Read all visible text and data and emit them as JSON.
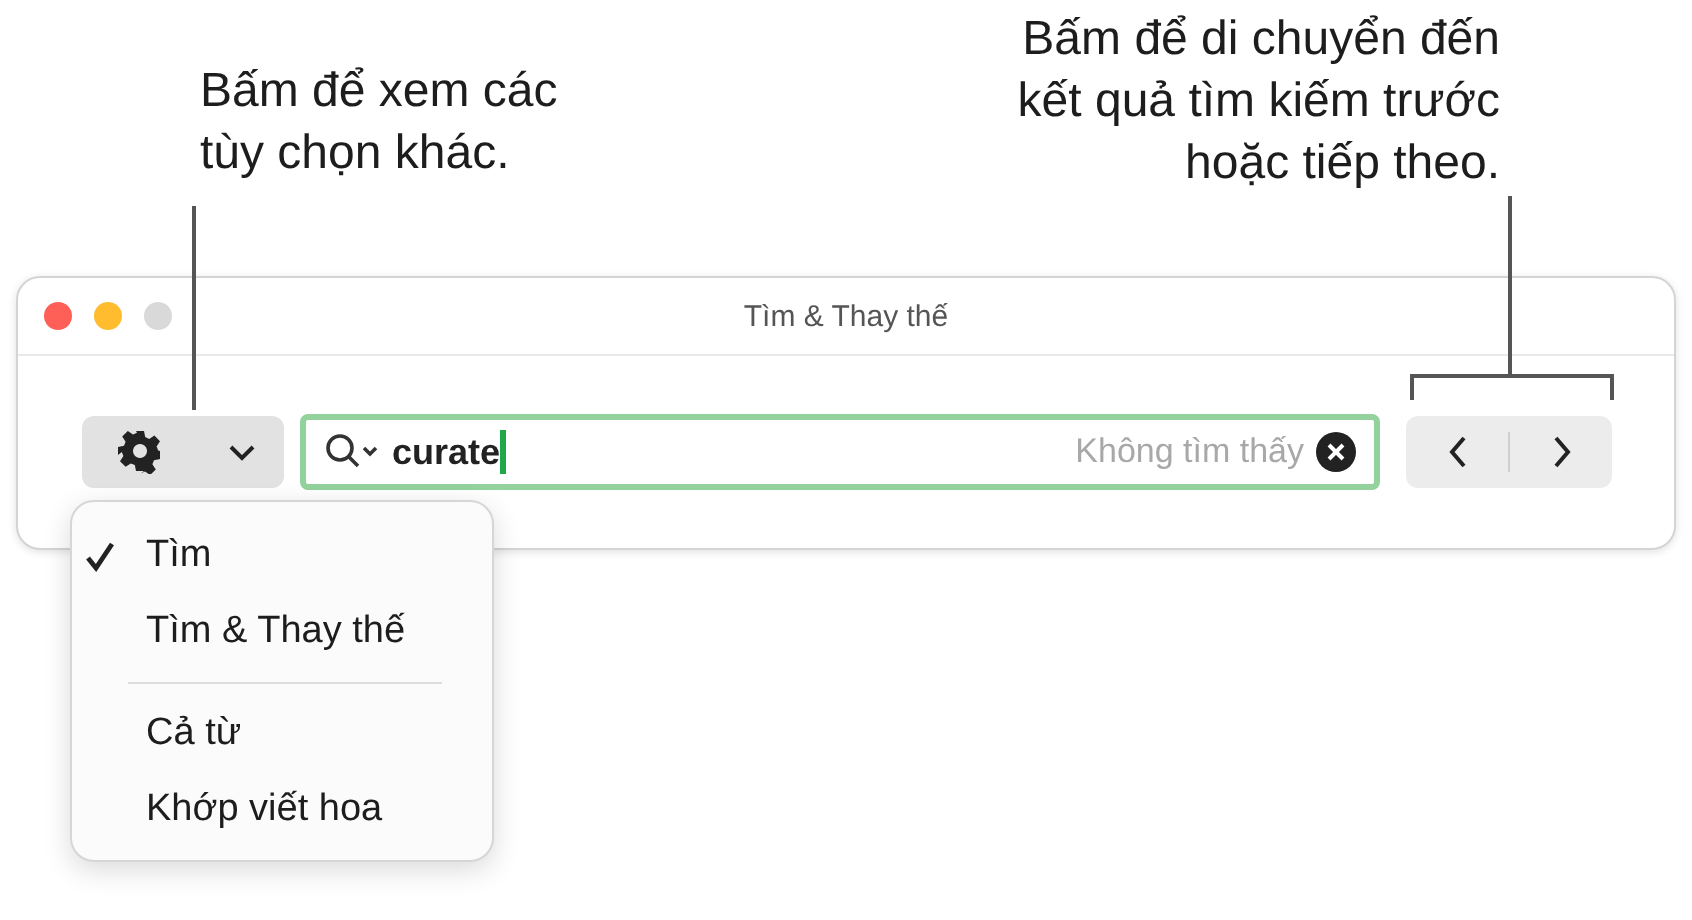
{
  "callouts": [
    {
      "text": "Bấm để xem các\ntùy chọn khác."
    },
    {
      "text": "Bấm để di chuyển đến\nkết quả tìm kiếm trước\nhoặc tiếp theo."
    }
  ],
  "window": {
    "title": "Tìm & Thay thế"
  },
  "search": {
    "value": "curate",
    "status": "Không tìm thấy"
  },
  "menu": {
    "sections": [
      [
        {
          "label": "Tìm",
          "checked": true
        },
        {
          "label": "Tìm & Thay thế",
          "checked": false
        }
      ],
      [
        {
          "label": "Cả từ",
          "checked": false
        },
        {
          "label": "Khớp viết hoa",
          "checked": false
        }
      ]
    ]
  }
}
